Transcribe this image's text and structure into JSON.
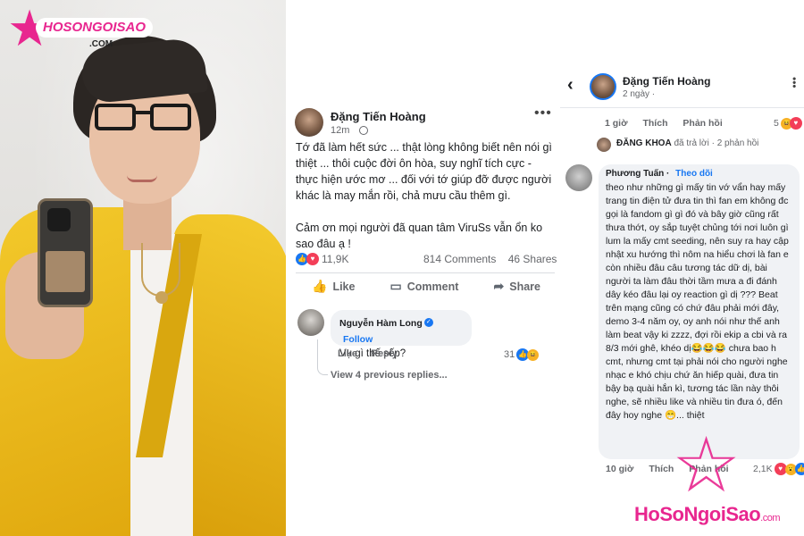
{
  "brand": {
    "name": "HOSONGOISAO",
    "suffix": ".COM",
    "watermark_main": "HoSoNgoiSao",
    "watermark_suffix": ".com",
    "color": "#e8268f"
  },
  "post": {
    "author": "Đặng Tiến Hoàng",
    "time": "12m",
    "more_label": "•••",
    "paragraph_1": "Tớ đã làm hết sức ... thật lòng không biết nên nói gì thiệt ... thôi cuộc đời ôn hòa, suy nghĩ tích cực - thực hiện ước mơ ... đối với tớ giúp đỡ được người khác là may mắn rồi, chả mưu cầu thêm gì.",
    "paragraph_2": "Cảm ơn mọi người đã quan tâm ViruSs vẫn ổn ko sao đâu ạ !",
    "reactions": "11,9K",
    "comments": "814 Comments",
    "shares": "46 Shares",
    "actions": {
      "like": "Like",
      "comment": "Comment",
      "share": "Share"
    },
    "comment": {
      "author": "Nguyễn Hàm Long",
      "follow": "Follow",
      "text": "Vụ gì thế sếp?",
      "like": "Like",
      "reply": "Reply",
      "count": "31",
      "view_more": "View 4 previous replies..."
    }
  },
  "thread": {
    "author": "Đặng Tiến Hoàng",
    "time": "2 ngày ·",
    "prev_meta": {
      "time": "1 giờ",
      "like": "Thích",
      "reply": "Phản hồi",
      "count": "5"
    },
    "reply_notice": {
      "name": "ĐĂNG KHOA",
      "text": "đã trả lời · 2 phản hồi"
    },
    "comment": {
      "author": "Phương Tuấn",
      "follow": "Theo dõi",
      "text": "theo như những gì mấy tin vớ vẩn hay mấy trang tin điện tử đưa tin thì fan em không đc gọi là fandom gì gì đó và bây giờ cũng rất thưa thớt, oy sắp tuyệt chủng tới nơi luôn gì lum la mấy cmt seeding, nên suy ra hay cập nhật xu hướng thì nôm na hiểu chơi là fan e còn nhiều đâu câu tương tác dữ dị, bài người ta làm đâu thời tầm mưa a đi đánh dây kéo đâu lại oy reaction gì dị ??? Beat trên mạng cũng có chứ đâu phải mới đây, demo 3-4 năm oy, oy anh nói như thế anh làm beat vậy ki zzzz, đợi rồi ekip a cbi và ra 8/3 mới ghê, khéo dị😂😂😂 chưa bao h cmt, nhưng cmt tại phải nói cho người nghe nhạc e khó chịu chứ ăn hiếp quài, đưa tin bậy bạ quài hắn kì, tương tác lần này thôi nghe, sẽ nhiều like và nhiều tin đưa ó, đến đây hoy nghe 😁... thiệt",
      "time": "10 giờ",
      "like": "Thích",
      "reply": "Phản hồi",
      "count": "2,1K"
    }
  },
  "icons": {
    "like": "thumbs-up-icon",
    "comment": "speech-bubble-icon",
    "share": "share-arrow-icon",
    "back": "chevron-left-icon",
    "globe": "globe-icon"
  }
}
